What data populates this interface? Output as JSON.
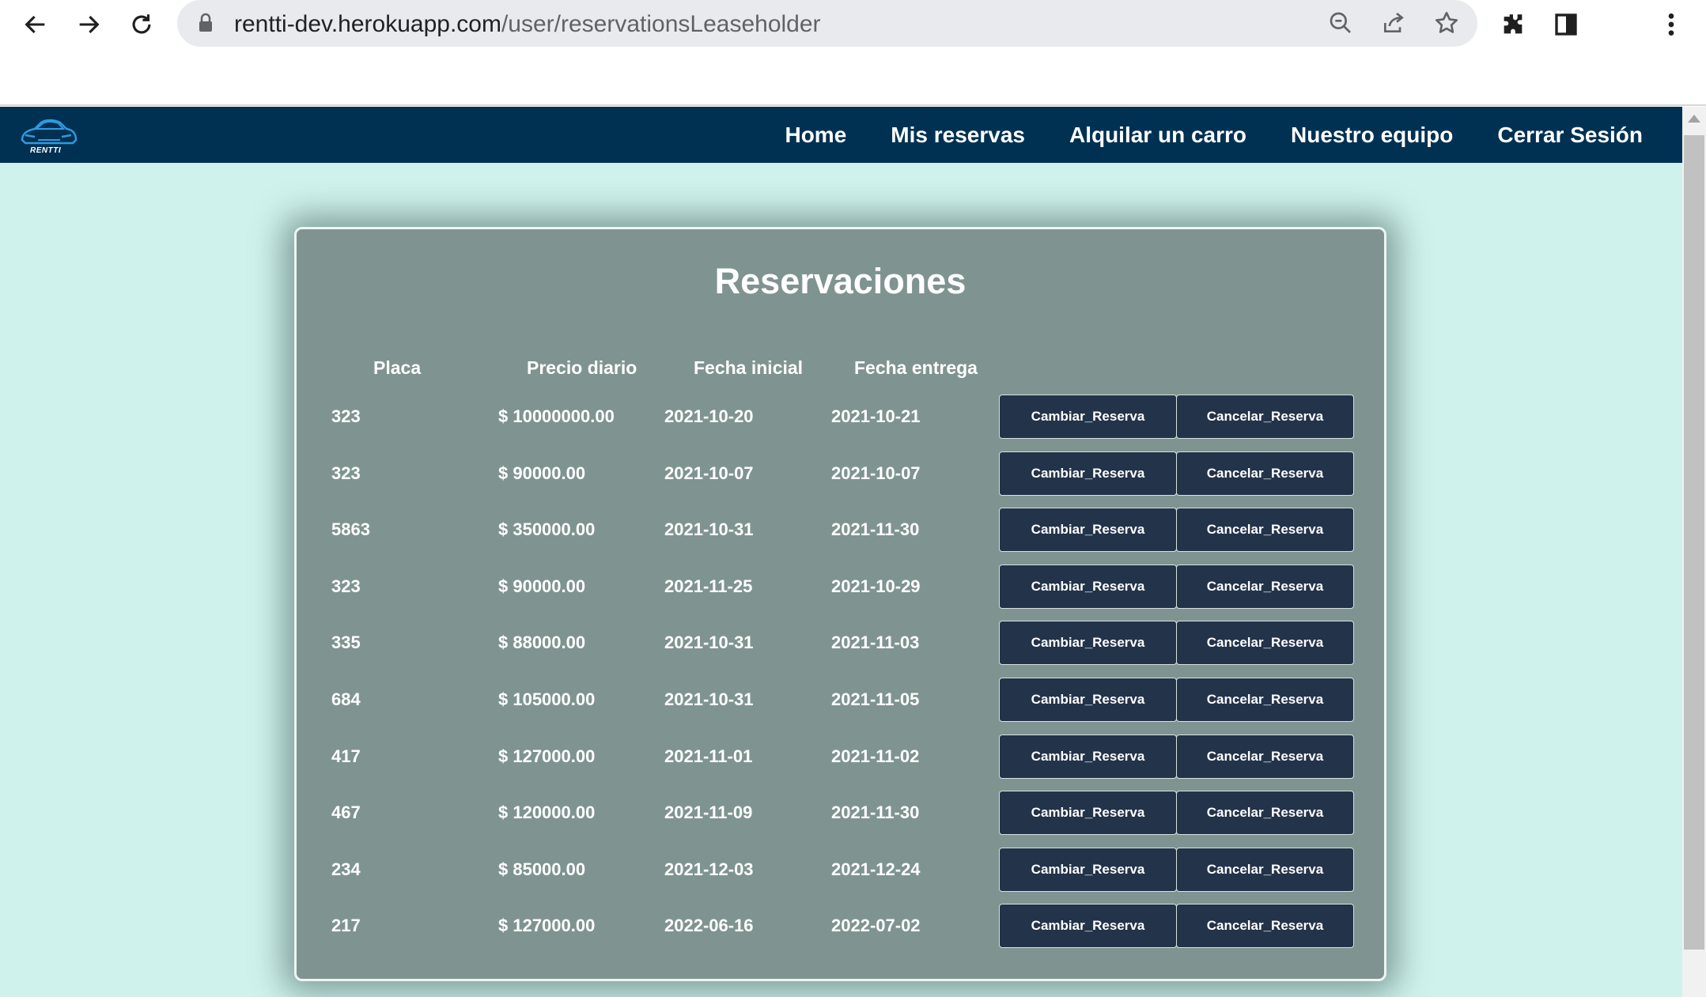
{
  "browser": {
    "url_host": "rentti-dev.herokuapp.com",
    "url_path": "/user/reservationsLeaseholder"
  },
  "nav": {
    "logo_text": "RENTTI",
    "links": [
      "Home",
      "Mis reservas",
      "Alquilar un carro",
      "Nuestro equipo",
      "Cerrar Sesión"
    ]
  },
  "reservations": {
    "title": "Reservaciones",
    "columns": [
      "Placa",
      "Precio diario",
      "Fecha inicial",
      "Fecha entrega"
    ],
    "change_label": "Cambiar_Reserva",
    "cancel_label": "Cancelar_Reserva",
    "rows": [
      {
        "placa": "323",
        "precio": "$ 10000000.00",
        "inicio": "2021-10-20",
        "entrega": "2021-10-21"
      },
      {
        "placa": "323",
        "precio": "$ 90000.00",
        "inicio": "2021-10-07",
        "entrega": "2021-10-07"
      },
      {
        "placa": "5863",
        "precio": "$ 350000.00",
        "inicio": "2021-10-31",
        "entrega": "2021-11-30"
      },
      {
        "placa": "323",
        "precio": "$ 90000.00",
        "inicio": "2021-11-25",
        "entrega": "2021-10-29"
      },
      {
        "placa": "335",
        "precio": "$ 88000.00",
        "inicio": "2021-10-31",
        "entrega": "2021-11-03"
      },
      {
        "placa": "684",
        "precio": "$ 105000.00",
        "inicio": "2021-10-31",
        "entrega": "2021-11-05"
      },
      {
        "placa": "417",
        "precio": "$ 127000.00",
        "inicio": "2021-11-01",
        "entrega": "2021-11-02"
      },
      {
        "placa": "467",
        "precio": "$ 120000.00",
        "inicio": "2021-11-09",
        "entrega": "2021-11-30"
      },
      {
        "placa": "234",
        "precio": "$ 85000.00",
        "inicio": "2021-12-03",
        "entrega": "2021-12-24"
      },
      {
        "placa": "217",
        "precio": "$ 127000.00",
        "inicio": "2022-06-16",
        "entrega": "2022-07-02"
      }
    ]
  }
}
